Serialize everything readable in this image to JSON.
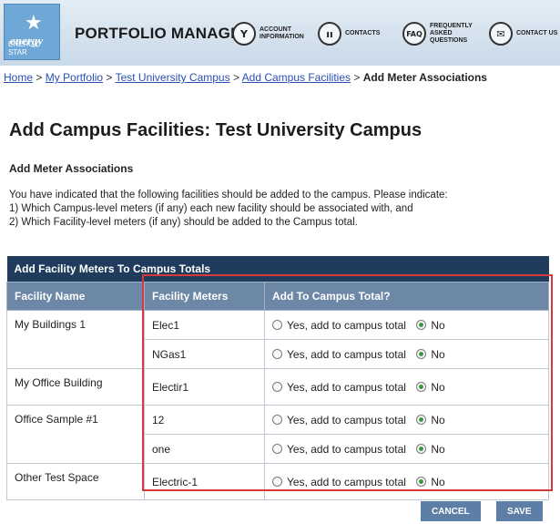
{
  "header": {
    "logo_text": "energy",
    "logo_sub": "ENERGY STAR",
    "title": "PORTFOLIO MANAGER",
    "nav": [
      {
        "icon": "key-icon",
        "glyph": "Y",
        "label": "ACCOUNT INFORMATION"
      },
      {
        "icon": "contacts-icon",
        "glyph": "ıı",
        "label": "CONTACTS"
      },
      {
        "icon": "faq-icon",
        "glyph": "FAQ",
        "label": "FREQUENTLY ASKED QUESTIONS"
      },
      {
        "icon": "contact-us-icon",
        "glyph": "✉",
        "label": "CONTACT US"
      }
    ]
  },
  "breadcrumb": {
    "links": [
      "Home",
      "My Portfolio",
      "Test University Campus",
      "Add Campus Facilities"
    ],
    "separator": ">",
    "current": "Add Meter Associations"
  },
  "page": {
    "title": "Add Campus Facilities: Test University Campus",
    "subheading": "Add Meter Associations",
    "intro": [
      "You have indicated that the following facilities should be added to the campus. Please indicate:",
      "1) Which Campus-level meters (if any) each new facility should be associated with, and",
      "2) Which Facility-level meters (if any) should be added to the Campus total."
    ]
  },
  "table": {
    "caption": "Add Facility Meters To Campus Totals",
    "headers": [
      "Facility Name",
      "Facility Meters",
      "Add To Campus Total?"
    ],
    "option_yes": "Yes, add to campus total",
    "option_no": "No",
    "facilities": [
      {
        "name": "My Buildings 1",
        "meters": [
          "Elec1",
          "NGas1"
        ]
      },
      {
        "name": "My Office Building",
        "meters": [
          "Electir1"
        ]
      },
      {
        "name": "Office Sample #1",
        "meters": [
          "12",
          "one"
        ]
      },
      {
        "name": "Other Test Space",
        "meters": [
          "Electric-1"
        ]
      }
    ],
    "selected": "No"
  },
  "actions": {
    "cancel": "CANCEL",
    "save": "SAVE"
  },
  "colors": {
    "header_bg": "#c9d9e8",
    "table_caption": "#1f3c5c",
    "table_header": "#6d87a6",
    "highlight": "#d9383a",
    "button": "#5c7ea7",
    "link": "#2a4fb3"
  }
}
